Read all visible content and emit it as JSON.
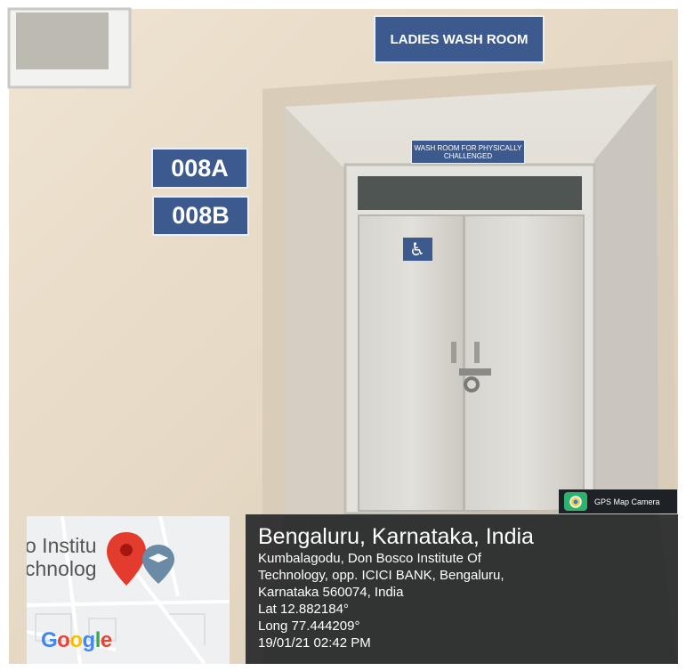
{
  "signs": {
    "ladies_wash_room": "LADIES WASH ROOM",
    "room_a": "008A",
    "room_b": "008B",
    "physically_challenged": "WASH ROOM FOR PHYSICALLY CHALLENGED"
  },
  "badge": {
    "app_name": "GPS Map Camera"
  },
  "map": {
    "label_line1": "o Institu",
    "label_line2": "chnolog",
    "logo_text": "Google"
  },
  "location": {
    "city": "Bengaluru, Karnataka, India",
    "address_line1": "Kumbalagodu, Don Bosco Institute Of",
    "address_line2": "Technology, opp. ICICI BANK, Bengaluru,",
    "address_line3": "Karnataka 560074, India",
    "lat": "Lat 12.882184°",
    "long": "Long 77.444209°",
    "datetime": "19/01/21 02:42 PM"
  },
  "colors": {
    "sign_blue": "#3d5a8f",
    "wall": "#e8dcc9",
    "door": "#d9d7d2",
    "pin_red": "#e43b2f",
    "panel_bg": "#191c1e"
  }
}
